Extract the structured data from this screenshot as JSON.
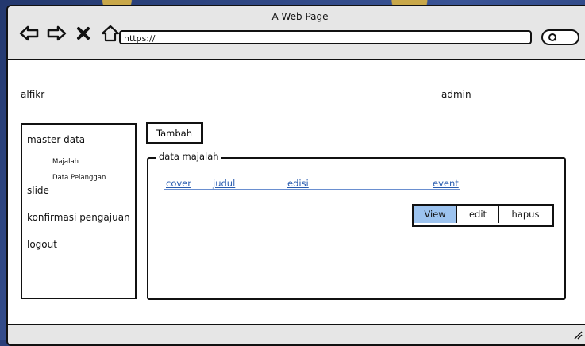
{
  "window": {
    "title": "A Web Page",
    "url": "https://"
  },
  "header": {
    "brand": "alfikr",
    "user": "admin"
  },
  "sidebar": {
    "items": [
      {
        "label": "master data"
      },
      {
        "label": "Majalah"
      },
      {
        "label": "Data Pelanggan"
      },
      {
        "label": "slide"
      },
      {
        "label": "konfirmasi pengajuan"
      },
      {
        "label": "logout"
      }
    ]
  },
  "main": {
    "add_button": "Tambah",
    "panel_title": "data majalah",
    "columns": [
      "cover",
      "judul",
      "edisi",
      "event"
    ],
    "row_actions": [
      "View",
      "edit",
      "hapus"
    ]
  }
}
